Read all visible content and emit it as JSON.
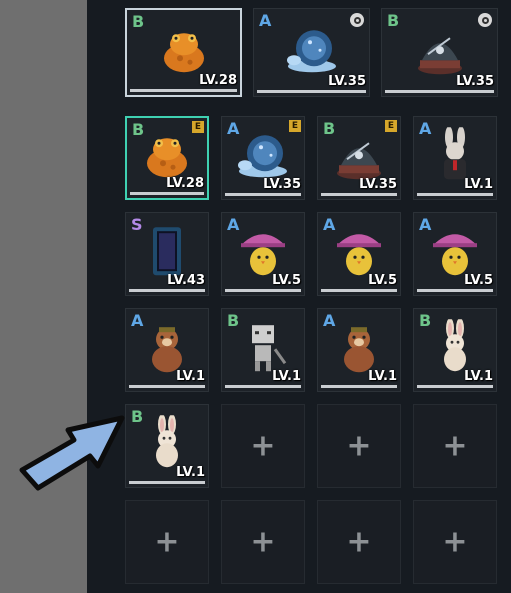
{
  "grade_colors": {
    "B": "#6ec48a",
    "A": "#5fa7e6",
    "S": "#b48ae8"
  },
  "top_row": [
    {
      "grade": "B",
      "level": "LV.28",
      "pet": "orange-toad",
      "state": "selected"
    },
    {
      "grade": "A",
      "level": "LV.35",
      "pet": "crystal-snail",
      "badge": "cycle"
    },
    {
      "grade": "B",
      "level": "LV.35",
      "pet": "crystal-dome",
      "badge": "cycle"
    }
  ],
  "grid": [
    {
      "grade": "B",
      "level": "LV.28",
      "pet": "orange-toad",
      "badge": "E",
      "state": "equipped"
    },
    {
      "grade": "A",
      "level": "LV.35",
      "pet": "crystal-snail",
      "badge": "E"
    },
    {
      "grade": "B",
      "level": "LV.35",
      "pet": "crystal-dome",
      "badge": "E"
    },
    {
      "grade": "A",
      "level": "LV.1",
      "pet": "suit-rabbit"
    },
    {
      "grade": "S",
      "level": "LV.43",
      "pet": "dark-portal"
    },
    {
      "grade": "A",
      "level": "LV.5",
      "pet": "mushroom-chick"
    },
    {
      "grade": "A",
      "level": "LV.5",
      "pet": "mushroom-chick"
    },
    {
      "grade": "A",
      "level": "LV.5",
      "pet": "mushroom-chick"
    },
    {
      "grade": "A",
      "level": "LV.1",
      "pet": "brown-beaver"
    },
    {
      "grade": "B",
      "level": "LV.1",
      "pet": "box-robot"
    },
    {
      "grade": "A",
      "level": "LV.1",
      "pet": "brown-beaver"
    },
    {
      "grade": "B",
      "level": "LV.1",
      "pet": "plush-bunny"
    },
    {
      "grade": "B",
      "level": "LV.1",
      "pet": "plush-bunny"
    },
    {
      "empty": true,
      "icon": "plus-icon"
    },
    {
      "empty": true,
      "icon": "plus-icon"
    },
    {
      "empty": true,
      "icon": "plus-icon"
    },
    {
      "empty": true,
      "icon": "plus-icon"
    },
    {
      "empty": true,
      "icon": "plus-icon"
    },
    {
      "empty": true,
      "icon": "plus-icon"
    },
    {
      "empty": true,
      "icon": "plus-icon"
    }
  ],
  "plus_label": "+",
  "annotation": {
    "icon": "pointer-arrow-icon",
    "color": "#8fb4e3"
  }
}
